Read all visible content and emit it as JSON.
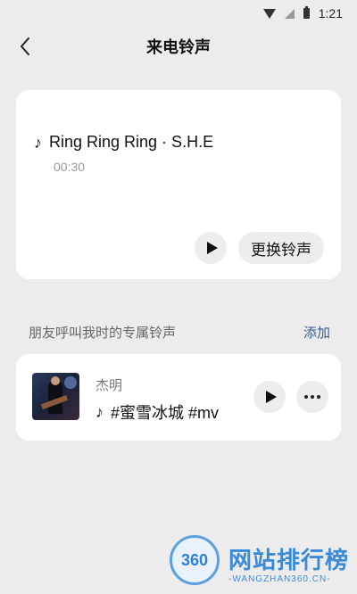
{
  "status_bar": {
    "time": "1:21"
  },
  "nav": {
    "title": "来电铃声"
  },
  "current_ringtone": {
    "title": "Ring Ring Ring · S.H.E",
    "duration": "00:30",
    "change_label": "更换铃声"
  },
  "friends_section": {
    "title": "朋友呼叫我时的专属铃声",
    "add_label": "添加",
    "items": [
      {
        "name": "杰明",
        "song": "#蜜雪冰城 #mv"
      }
    ]
  },
  "watermark": {
    "logo_text": "360",
    "title": "网站排行榜",
    "subtitle": "-WANGZHAN360.CN-"
  },
  "colors": {
    "accent": "#3c5a8a",
    "background": "#ececec",
    "card": "#ffffff",
    "button_bg": "#ededed"
  }
}
